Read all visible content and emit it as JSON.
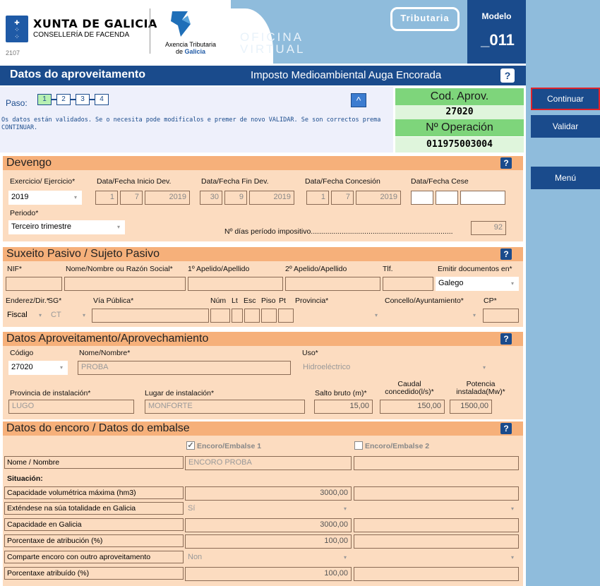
{
  "header": {
    "xunta_title": "XUNTA DE GALICIA",
    "xunta_sub": "CONSELLERÍA DE FACENDA",
    "xunta_code": "2107",
    "atg_line1": "Axencia Tributaria",
    "atg_line2a": "de ",
    "atg_line2b": "Galicia",
    "oficina": "OFICINA",
    "virtual": "VIRTUAL",
    "tributaria": "Tributaria",
    "modelo_label": "Modelo",
    "modelo_num": "011"
  },
  "titlebar": {
    "title": "Datos do aproveitamento",
    "subtitle": "Imposto Medioambiental Auga Encorada",
    "help": "?"
  },
  "sidebar": {
    "continuar": "Continuar",
    "validar": "Validar",
    "menu": "Menú"
  },
  "steps": {
    "paso_label": "Paso:",
    "items": [
      "1",
      "2",
      "3",
      "4"
    ],
    "current": 1,
    "up_icon": "^",
    "message": "Os datos están validados. Se o necesita pode modificalos e premer de novo VALIDAR. Se son correctos prema CONTINUAR."
  },
  "codbox": {
    "cod_label": "Cod. Aprov.",
    "cod_value": "27020",
    "op_label": "Nº Operación",
    "op_value": "011975003004"
  },
  "devengo": {
    "title": "Devengo",
    "ejercicio_label": "Exercicio/ Ejercicio*",
    "ejercicio_value": "2019",
    "inicio_label": "Data/Fecha Inicio Dev.",
    "inicio": [
      "1",
      "7",
      "2019"
    ],
    "fin_label": "Data/Fecha Fin Dev.",
    "fin": [
      "30",
      "9",
      "2019"
    ],
    "concesion_label": "Data/Fecha Concesión",
    "concesion": [
      "1",
      "7",
      "2019"
    ],
    "cese_label": "Data/Fecha Cese",
    "periodo_label": "Periodo*",
    "periodo_value": "Terceiro trimestre",
    "dias_label": "Nº días período impositivo.....................................................................",
    "dias_value": "92"
  },
  "suxeito": {
    "title": "Suxeito Pasivo / Sujeto Pasivo",
    "nif_label": "NIF*",
    "nome_label": "Nome/Nombre ou Razón Social*",
    "ap1_label": "1º Apelido/Apellido",
    "ap2_label": "2º Apelido/Apellido",
    "tlf_label": "Tlf.",
    "emitir_label": "Emitir documentos en*",
    "emitir_value": "Galego",
    "enderezo_label": "Enderez/Dir.*",
    "sg_label": "SG*",
    "via_label": "Vía Pública*",
    "num_label": "Núm",
    "lt_label": "Lt",
    "esc_label": "Esc",
    "piso_label": "Piso",
    "pt_label": "Pt",
    "provincia_label": "Provincia*",
    "concello_label": "Concello/Ayuntamiento*",
    "cp_label": "CP*",
    "enderezo_value": "Fiscal",
    "sg_value": "CT"
  },
  "aproveitamento": {
    "title": "Datos Aproveitamento/Aprovechamiento",
    "codigo_label": "Código",
    "codigo_value": "27020",
    "nome_label": "Nome/Nombre*",
    "nome_value": "PROBA",
    "uso_label": "Uso*",
    "uso_value": "Hidroeléctrico",
    "provincia_label": "Provincia de instalación*",
    "provincia_value": "LUGO",
    "lugar_label": "Lugar de instalación*",
    "lugar_value": "MONFORTE",
    "salto_label": "Salto bruto (m)*",
    "salto_value": "15,00",
    "caudal_label1": "Caudal",
    "caudal_label2": "concedido(l/s)*",
    "caudal_value": "150,00",
    "potencia_label1": "Potencia",
    "potencia_label2": "instalada(Mw)*",
    "potencia_value": "1500,00"
  },
  "encoro": {
    "title": "Datos do encoro / Datos do embalse",
    "col1": "Encoro/Embalse 1",
    "col2": "Encoro/Embalse 2",
    "nome_label": "Nome / Nombre",
    "nome_value": "ENCORO PROBA",
    "situacion": "Situación:",
    "cap_max_label": "Capacidade volumétrica máxima (hm3)",
    "cap_max_value": "3000,00",
    "extende_label": "Exténdese na súa totalidade en Galicia",
    "extende_value": "Sí",
    "cap_gal_label": "Capacidade en Galicia",
    "cap_gal_value": "3000,00",
    "pct_atrib_label": "Porcentaxe de atribución   (%)",
    "pct_atrib_value": "100,00",
    "comparte_label": "Comparte encoro con outro aproveitamento",
    "comparte_value": "Non",
    "pct_atribuido_label": "Porcentaxe atribuído   (%)",
    "pct_atribuido_value": "100,00"
  }
}
